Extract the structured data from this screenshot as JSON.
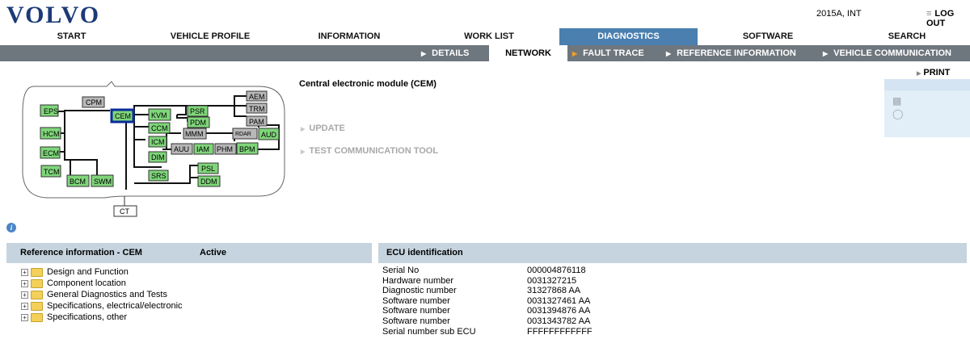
{
  "header": {
    "logo_text": "VOLVO",
    "version": "2015A, INT",
    "logout": "LOG OUT"
  },
  "main_nav": [
    {
      "label": "START",
      "active": false
    },
    {
      "label": "VEHICLE PROFILE",
      "active": false
    },
    {
      "label": "INFORMATION",
      "active": false
    },
    {
      "label": "WORK LIST",
      "active": false
    },
    {
      "label": "DIAGNOSTICS",
      "active": true
    },
    {
      "label": "SOFTWARE",
      "active": false
    },
    {
      "label": "SEARCH",
      "active": false
    }
  ],
  "sub_nav": [
    {
      "label": "DETAILS",
      "active": false
    },
    {
      "label": "NETWORK",
      "active": true
    },
    {
      "label": "FAULT TRACE",
      "active": false
    },
    {
      "label": "REFERENCE INFORMATION",
      "active": false
    },
    {
      "label": "VEHICLE COMMUNICATION",
      "active": false
    }
  ],
  "network": {
    "selected": "CEM",
    "modules": {
      "eps": "EPS",
      "hcm": "HCM",
      "ecm": "ECM",
      "tcm": "TCM",
      "bcm": "BCM",
      "swm": "SWM",
      "cpm": "CPM",
      "cem": "CEM",
      "kvm": "KVM",
      "psr": "PSR",
      "pdm": "PDM",
      "aem": "AEM",
      "trm": "TRM",
      "pam": "PAM",
      "ccm": "CCM",
      "mmm": "MMM",
      "rdar": "RDAR",
      "aud": "AUD",
      "icm": "ICM",
      "auu": "AUU",
      "iam": "IAM",
      "phm": "PHM",
      "bpm": "BPM",
      "dim": "DIM",
      "srs": "SRS",
      "psl": "PSL",
      "ddm": "DDM",
      "ct": "CT"
    }
  },
  "module": {
    "title": "Central electronic module (CEM)",
    "actions": [
      "UPDATE",
      "TEST COMMUNICATION TOOL"
    ],
    "print": "PRINT"
  },
  "reference": {
    "title": "Reference information - CEM",
    "status": "Active",
    "items": [
      "Design and Function",
      "Component location",
      "General Diagnostics and Tests",
      "Specifications, electrical/electronic",
      "Specifications, other"
    ]
  },
  "ecu": {
    "title": "ECU identification",
    "rows": [
      {
        "label": "Serial No",
        "value": "000004876118"
      },
      {
        "label": "Hardware number",
        "value": "0031327215"
      },
      {
        "label": "Diagnostic number",
        "value": "31327868 AA"
      },
      {
        "label": "Software number",
        "value": "0031327461 AA"
      },
      {
        "label": "Software number",
        "value": "0031394876 AA"
      },
      {
        "label": "Software number",
        "value": "0031343782 AA"
      },
      {
        "label": "Serial number sub ECU",
        "value": "FFFFFFFFFFFF"
      }
    ]
  },
  "colors": {
    "brand": "#1c3a78",
    "active_tab": "#4a7fb0",
    "subnav_bg": "#6e767e",
    "module_green": "#7fd67a",
    "module_gray": "#b8b8b8",
    "panel_header": "#c5d4de"
  }
}
